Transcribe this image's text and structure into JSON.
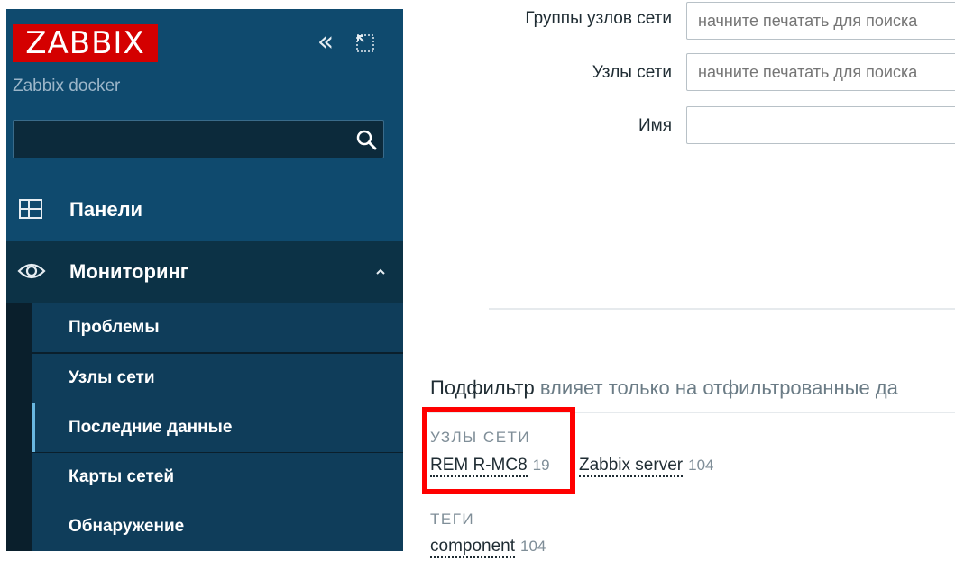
{
  "brand": {
    "logo_text": "ZABBIX",
    "server_name": "Zabbix docker",
    "logo_color": "#d40000"
  },
  "sidebar": {
    "collapse_icon": "double-chevron-left-icon",
    "kiosk_icon": "expand-icon",
    "search": {
      "placeholder": "",
      "icon": "search-icon"
    },
    "items": [
      {
        "label": "Панели",
        "icon": "dashboard-icon"
      },
      {
        "label": "Мониторинг",
        "icon": "eye-icon",
        "expanded": true
      }
    ],
    "monitoring_submenu": [
      {
        "label": "Проблемы"
      },
      {
        "label": "Узлы сети"
      },
      {
        "label": "Последние данные",
        "active": true
      },
      {
        "label": "Карты сетей"
      },
      {
        "label": "Обнаружение"
      }
    ],
    "colors": {
      "background": "#0f4a6e",
      "active_bar": "#69b7e0"
    }
  },
  "filter": {
    "host_groups": {
      "label": "Группы узлов сети",
      "placeholder": "начните печатать для поиска"
    },
    "hosts": {
      "label": "Узлы сети",
      "placeholder": "начните печатать для поиска"
    },
    "name": {
      "label": "Имя",
      "value": ""
    }
  },
  "subfilter": {
    "title": "Подфильтр",
    "note": "влияет только на отфильтрованные да",
    "hosts_section": {
      "title": "УЗЛЫ СЕТИ",
      "items": [
        {
          "name": "REM R-MC8",
          "count": "19"
        },
        {
          "name": "Zabbix server",
          "count": "104"
        }
      ]
    },
    "tags_section": {
      "title": "ТЕГИ",
      "items": [
        {
          "name": "component",
          "count": "104"
        }
      ]
    },
    "highlight_color": "#ff0000"
  }
}
